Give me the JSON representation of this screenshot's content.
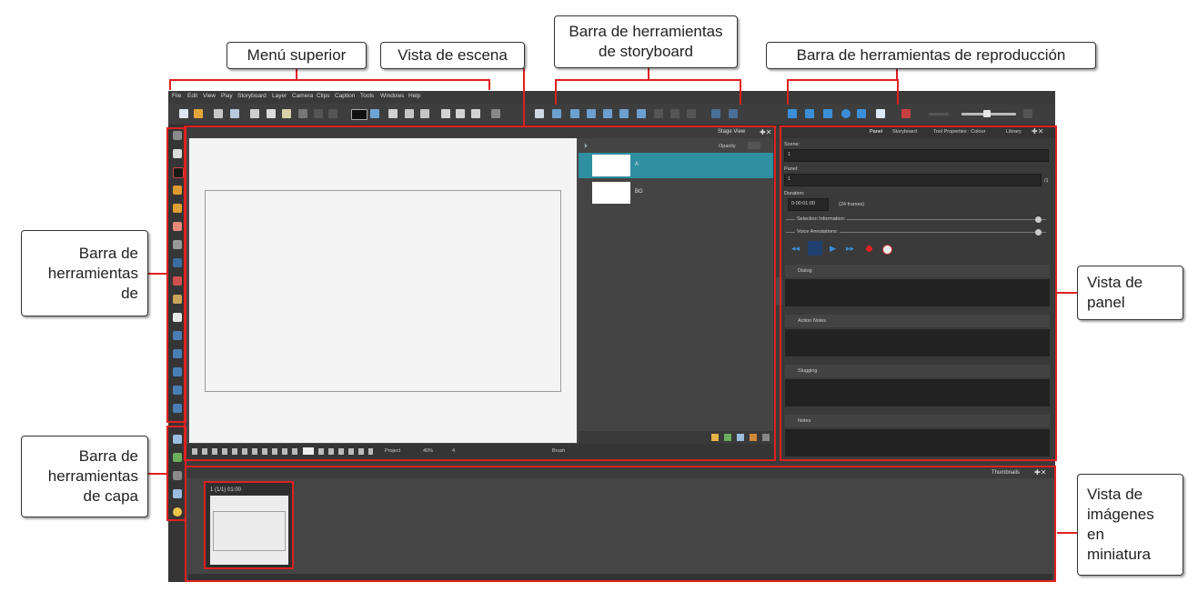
{
  "callouts": {
    "menu": "Menú superior",
    "scene": "Vista de escena",
    "storyboard": "Barra de herramientas\nde storyboard",
    "playback": "Barra de herramientas de reproducción",
    "tools": "Barra de\nherramientas\nde",
    "layer": "Barra de\nherramientas\nde capa",
    "panel": "Vista de\npanel",
    "thumbs": "Vista de\nimágenes\nen\nminiatura"
  },
  "menubar": [
    "File",
    "Edit",
    "View",
    "Play",
    "Storyboard",
    "Layer",
    "Camera",
    "Clips",
    "Caption",
    "Tools",
    "Windows",
    "Help"
  ],
  "stage": {
    "title": "Stage View",
    "opacity_label": "Opacity",
    "layers": [
      {
        "name": "A"
      },
      {
        "name": "BG"
      }
    ],
    "bottom": {
      "zoom": "Project",
      "percent": "40%",
      "num": "4",
      "brush": "Brush"
    }
  },
  "panel": {
    "tabs": [
      "Panel",
      "Storyboard",
      "Tool Properties : Colour",
      "Library"
    ],
    "scene_label": "Scene:",
    "scene_value": "1",
    "panel_label": "Panel:",
    "panel_value": "1",
    "panel_total": "/1",
    "duration_label": "Duration:",
    "duration_value": "0:00:01:00",
    "duration_frames": "(24 frames)",
    "selection_info": "Selection Information:",
    "voice_annotations": "Voice Annotations:",
    "sections": [
      "Dialog",
      "Action Notes",
      "Slugging",
      "Notes"
    ]
  },
  "thumbnails": {
    "title": "Thumbnails",
    "card_label": "1 (1/1) 01:00"
  },
  "colors": {
    "annotation": "#e02020",
    "selected_layer": "#2e8fa0"
  }
}
